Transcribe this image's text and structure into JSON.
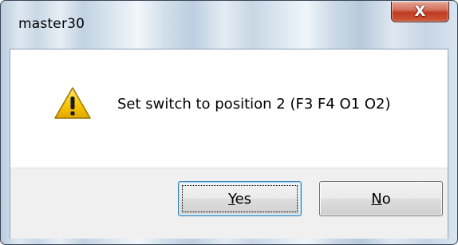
{
  "window": {
    "title": "master30",
    "close_glyph": "X"
  },
  "dialog": {
    "icon": "warning-icon",
    "message": "Set switch to position 2 (F3 F4 O1 O2)"
  },
  "buttons": {
    "yes": {
      "mnemonic": "Y",
      "rest": "es"
    },
    "no": {
      "mnemonic": "N",
      "rest": "o"
    }
  },
  "colors": {
    "warning_fill": "#f5c400",
    "close_button": "#c8452c"
  }
}
